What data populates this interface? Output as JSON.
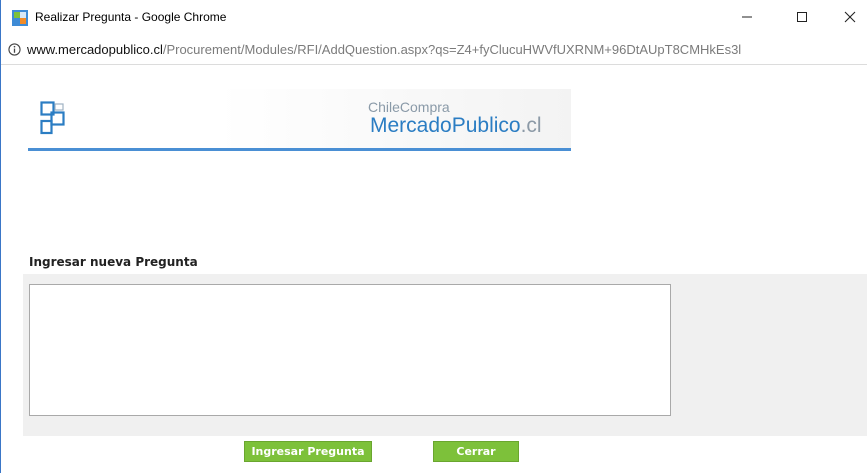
{
  "window": {
    "title": "Realizar Pregunta - Google Chrome",
    "controls": {
      "minimize": "—",
      "maximize": "☐",
      "close": "✕"
    }
  },
  "address_bar": {
    "url_host": "www.mercadopublico.cl",
    "url_path": "/Procurement/Modules/RFI/AddQuestion.aspx?qs=Z4+fyClucuHWVfUXRNM+96DtAUpT8CMHkEs3l"
  },
  "logo": {
    "subtitle": "ChileCompra",
    "title_main": "MercadoPublico",
    "title_suffix": ".cl"
  },
  "form": {
    "section_label": "Ingresar nueva Pregunta",
    "question_value": ""
  },
  "buttons": {
    "submit_label": "Ingresar Pregunta",
    "close_label": "Cerrar"
  },
  "colors": {
    "button_green": "#7dc13a",
    "brand_blue": "#2b7dc3",
    "window_border": "#3a76c7"
  }
}
